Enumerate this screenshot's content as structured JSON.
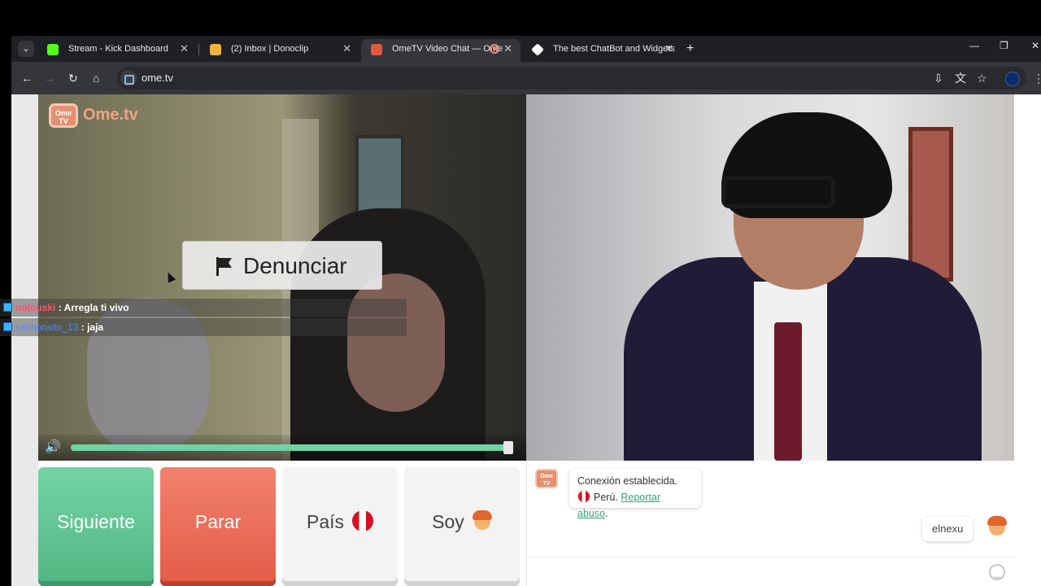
{
  "browser": {
    "tabs": [
      {
        "title": "Stream - Kick Dashboard",
        "icon": "kick-icon",
        "color": "#53fc18"
      },
      {
        "title": "(2) Inbox | Donoclip",
        "icon": "donoclip-icon",
        "color": "#f0b43c"
      },
      {
        "title": "OmeTV Video Chat — Ome",
        "icon": "ometv-icon",
        "color": "#e3573c",
        "active": true
      },
      {
        "title": "The best ChatBot and Widgets",
        "icon": "botrix-icon",
        "color": "#ffffff"
      }
    ],
    "url": "ome.tv"
  },
  "app": {
    "logo_text": "Ome.tv",
    "logo_badge": "Ome TV",
    "report_button": "Denunciar",
    "volume_level_pct": 100,
    "buttons": {
      "next": "Siguiente",
      "stop": "Parar",
      "country": "País",
      "gender": "Soy"
    },
    "chat": {
      "system_line1": "Conexión establecida.",
      "system_country": "Perú.",
      "report_abuse": "Reportar abuso",
      "user_message": "elnexu"
    }
  },
  "stream_chat": [
    {
      "user": "nolouski",
      "message": ": Arregla ti vivo"
    },
    {
      "user": "salmonsito_13",
      "message": ": jaja"
    }
  ],
  "colors": {
    "accent_green": "#6fd3a4",
    "stop_red": "#e25e47",
    "brand_orange": "#e39073"
  }
}
